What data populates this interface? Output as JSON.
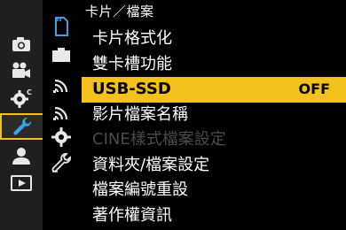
{
  "header": {
    "title": "卡片／檔案"
  },
  "left_menu": {
    "items": [
      {
        "icon": "camera-icon"
      },
      {
        "icon": "video-camera-icon"
      },
      {
        "icon": "gear-custom-icon"
      },
      {
        "icon": "wrench-setup-icon",
        "selected": true
      },
      {
        "icon": "person-my-menu-icon"
      },
      {
        "icon": "playback-icon"
      }
    ]
  },
  "sub_menu": {
    "items": [
      {
        "icon": "sd-card-icon",
        "selected": true
      },
      {
        "icon": "monitor-display-icon"
      },
      {
        "icon": "wireless-signal-icon"
      },
      {
        "icon": "wireless-signal-2-icon"
      },
      {
        "icon": "gear-settings-icon"
      },
      {
        "icon": "wrench-tool-icon"
      }
    ]
  },
  "menu": {
    "items": [
      {
        "label": "卡片格式化",
        "value": "",
        "state": "normal"
      },
      {
        "label": "雙卡槽功能",
        "value": "",
        "state": "normal"
      },
      {
        "label": "USB-SSD",
        "value": "OFF",
        "state": "selected"
      },
      {
        "label": "影片檔案名稱",
        "value": "",
        "state": "normal"
      },
      {
        "label": "CINE樣式檔案設定",
        "value": "",
        "state": "disabled"
      },
      {
        "label": "資料夾/檔案設定",
        "value": "",
        "state": "normal"
      },
      {
        "label": "檔案編號重設",
        "value": "",
        "state": "normal"
      },
      {
        "label": "著作權資訊",
        "value": "",
        "state": "normal"
      }
    ]
  },
  "colors": {
    "accent": "#f2c21a",
    "background": "#000000",
    "left_column": "#1f1f1f",
    "disabled_text": "#4b4b4b"
  }
}
